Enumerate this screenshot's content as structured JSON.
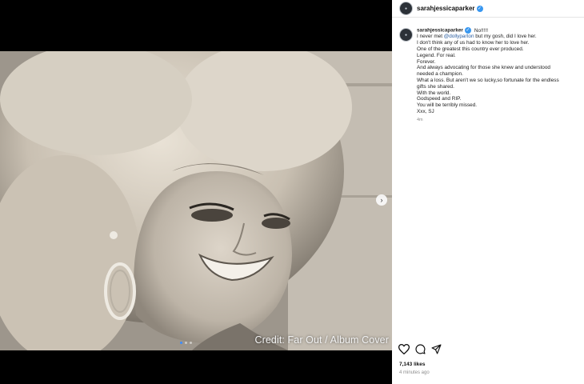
{
  "post": {
    "username": "sarahjessicaparker",
    "avatar_icon": "profile-avatar",
    "verified_icon": "verified-badge-icon",
    "credit_text": "Credit: Far Out / Album Cover",
    "carousel": {
      "count": 3,
      "active": 1
    }
  },
  "caption": {
    "first_text": "No!!!!!",
    "lines": [
      {
        "before": "I never met ",
        "mention": "@dollyparton",
        "after": " but my gosh, did I love her."
      },
      {
        "text": "I don't think any of us had to know her to love her."
      },
      {
        "text": "One of the greatest this country ever produced."
      },
      {
        "text": "Legend. For real."
      },
      {
        "text": "Forever."
      },
      {
        "text": "And always advocating for those she knew and understood"
      },
      {
        "text": "needed a champion."
      },
      {
        "text": "What a loss. But aren't we so lucky,so fortunate for the endless"
      },
      {
        "text": "gifts she shared."
      },
      {
        "text": "With the world."
      },
      {
        "text": "Godspeed and RIP."
      },
      {
        "text": "You will be terribly missed."
      },
      {
        "text": "Xxx, SJ"
      }
    ],
    "time_short": "4m"
  },
  "footer": {
    "likes": "7,143 likes",
    "time_ago": "4 minutes ago",
    "icons": [
      "heart-icon",
      "comment-icon",
      "share-icon"
    ]
  },
  "colors": {
    "accent": "#3897f0",
    "mention": "#2a5d9f",
    "muted": "#8e8e8e"
  }
}
